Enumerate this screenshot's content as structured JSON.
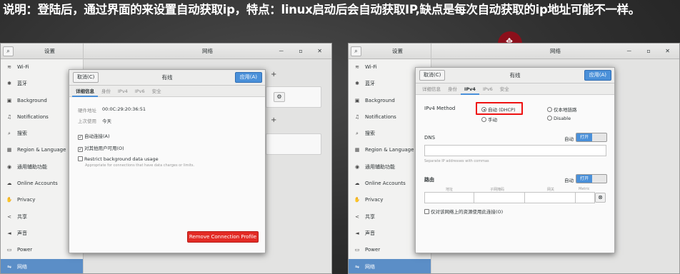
{
  "caption": "说明：登陆后，通过界面的来设置自动获取ip，特点：linux启动后会自动获取IP,缺点是每次自动获取的ip地址可能不一样。",
  "window": {
    "search_icon": "search-icon",
    "sidebar_title": "设置",
    "title": "网络",
    "controls": "－ ▫ ✕"
  },
  "sidebar_items": [
    {
      "icon": "wifi-icon",
      "glyph": "≋",
      "label": "Wi-Fi"
    },
    {
      "icon": "bluetooth-icon",
      "glyph": "✱",
      "label": "蓝牙"
    },
    {
      "icon": "background-icon",
      "glyph": "▣",
      "label": "Background"
    },
    {
      "icon": "bell-icon",
      "glyph": "♫",
      "label": "Notifications"
    },
    {
      "icon": "search-icon",
      "glyph": "⌕",
      "label": "搜索"
    },
    {
      "icon": "keyboard-icon",
      "glyph": "▦",
      "label": "Region & Language"
    },
    {
      "icon": "accessibility-icon",
      "glyph": "◉",
      "label": "通用辅助功能"
    },
    {
      "icon": "online-accounts-icon",
      "glyph": "☁",
      "label": "Online Accounts"
    },
    {
      "icon": "privacy-icon",
      "glyph": "✋",
      "label": "Privacy"
    },
    {
      "icon": "share-icon",
      "glyph": "<",
      "label": "共享"
    },
    {
      "icon": "sound-icon",
      "glyph": "◄",
      "label": "声音"
    },
    {
      "icon": "power-icon",
      "glyph": "▭",
      "label": "Power"
    },
    {
      "icon": "network-icon",
      "glyph": "⇋",
      "label": "网络"
    }
  ],
  "dialog": {
    "cancel": "取消(C)",
    "title": "有线",
    "apply": "应用(A)"
  },
  "left_dialog": {
    "tabs": [
      "详细信息",
      "身份",
      "IPv4",
      "IPv6",
      "安全"
    ],
    "active_tab": "详细信息",
    "hw_label": "硬件地址",
    "hw_value": "00:0C:29:20:36:51",
    "last_used_label": "上次使用",
    "last_used_value": "今天",
    "auto_connect": "自动连接(A)",
    "all_users": "对其他用户可用(O)",
    "restrict_title": "Restrict background data usage",
    "restrict_hint": "Appropriate for connections that have data charges or limits.",
    "remove_button": "Remove Connection Profile"
  },
  "right_dialog": {
    "tabs": [
      "详细信息",
      "身份",
      "IPv4",
      "IPv6",
      "安全"
    ],
    "active_tab": "IPv4",
    "ipv4_method_label": "IPv4 Method",
    "methods": {
      "auto_dhcp": "自动 (DHCP)",
      "link_local": "仅本地链路",
      "manual": "手动",
      "disable": "Disable"
    },
    "dns_label": "DNS",
    "auto_label": "自动",
    "toggle_on": "打开",
    "dns_hint": "Separate IP addresses with commas",
    "route_label": "路由",
    "route_columns": [
      "地址",
      "子网掩码",
      "网关",
      "Metric"
    ],
    "only_local": "仅对该网络上的资源使用此连接(O)"
  },
  "colors": {
    "accent": "#4a90d9",
    "destructive": "#e32b25",
    "highlight_box": "#ee1111"
  }
}
